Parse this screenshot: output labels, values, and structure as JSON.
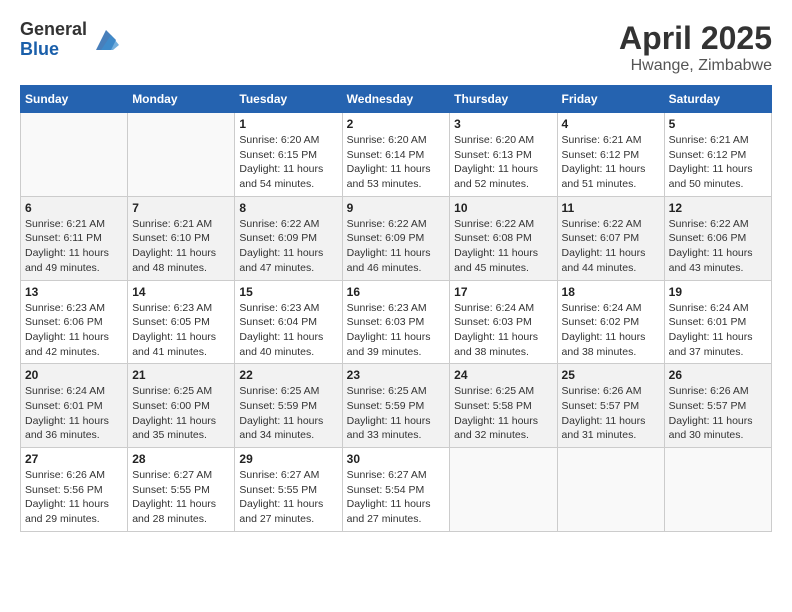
{
  "header": {
    "logo_general": "General",
    "logo_blue": "Blue",
    "title": "April 2025",
    "location": "Hwange, Zimbabwe"
  },
  "calendar": {
    "days_of_week": [
      "Sunday",
      "Monday",
      "Tuesday",
      "Wednesday",
      "Thursday",
      "Friday",
      "Saturday"
    ],
    "weeks": [
      [
        {
          "day": "",
          "info": ""
        },
        {
          "day": "",
          "info": ""
        },
        {
          "day": "1",
          "info": "Sunrise: 6:20 AM\nSunset: 6:15 PM\nDaylight: 11 hours\nand 54 minutes."
        },
        {
          "day": "2",
          "info": "Sunrise: 6:20 AM\nSunset: 6:14 PM\nDaylight: 11 hours\nand 53 minutes."
        },
        {
          "day": "3",
          "info": "Sunrise: 6:20 AM\nSunset: 6:13 PM\nDaylight: 11 hours\nand 52 minutes."
        },
        {
          "day": "4",
          "info": "Sunrise: 6:21 AM\nSunset: 6:12 PM\nDaylight: 11 hours\nand 51 minutes."
        },
        {
          "day": "5",
          "info": "Sunrise: 6:21 AM\nSunset: 6:12 PM\nDaylight: 11 hours\nand 50 minutes."
        }
      ],
      [
        {
          "day": "6",
          "info": "Sunrise: 6:21 AM\nSunset: 6:11 PM\nDaylight: 11 hours\nand 49 minutes."
        },
        {
          "day": "7",
          "info": "Sunrise: 6:21 AM\nSunset: 6:10 PM\nDaylight: 11 hours\nand 48 minutes."
        },
        {
          "day": "8",
          "info": "Sunrise: 6:22 AM\nSunset: 6:09 PM\nDaylight: 11 hours\nand 47 minutes."
        },
        {
          "day": "9",
          "info": "Sunrise: 6:22 AM\nSunset: 6:09 PM\nDaylight: 11 hours\nand 46 minutes."
        },
        {
          "day": "10",
          "info": "Sunrise: 6:22 AM\nSunset: 6:08 PM\nDaylight: 11 hours\nand 45 minutes."
        },
        {
          "day": "11",
          "info": "Sunrise: 6:22 AM\nSunset: 6:07 PM\nDaylight: 11 hours\nand 44 minutes."
        },
        {
          "day": "12",
          "info": "Sunrise: 6:22 AM\nSunset: 6:06 PM\nDaylight: 11 hours\nand 43 minutes."
        }
      ],
      [
        {
          "day": "13",
          "info": "Sunrise: 6:23 AM\nSunset: 6:06 PM\nDaylight: 11 hours\nand 42 minutes."
        },
        {
          "day": "14",
          "info": "Sunrise: 6:23 AM\nSunset: 6:05 PM\nDaylight: 11 hours\nand 41 minutes."
        },
        {
          "day": "15",
          "info": "Sunrise: 6:23 AM\nSunset: 6:04 PM\nDaylight: 11 hours\nand 40 minutes."
        },
        {
          "day": "16",
          "info": "Sunrise: 6:23 AM\nSunset: 6:03 PM\nDaylight: 11 hours\nand 39 minutes."
        },
        {
          "day": "17",
          "info": "Sunrise: 6:24 AM\nSunset: 6:03 PM\nDaylight: 11 hours\nand 38 minutes."
        },
        {
          "day": "18",
          "info": "Sunrise: 6:24 AM\nSunset: 6:02 PM\nDaylight: 11 hours\nand 38 minutes."
        },
        {
          "day": "19",
          "info": "Sunrise: 6:24 AM\nSunset: 6:01 PM\nDaylight: 11 hours\nand 37 minutes."
        }
      ],
      [
        {
          "day": "20",
          "info": "Sunrise: 6:24 AM\nSunset: 6:01 PM\nDaylight: 11 hours\nand 36 minutes."
        },
        {
          "day": "21",
          "info": "Sunrise: 6:25 AM\nSunset: 6:00 PM\nDaylight: 11 hours\nand 35 minutes."
        },
        {
          "day": "22",
          "info": "Sunrise: 6:25 AM\nSunset: 5:59 PM\nDaylight: 11 hours\nand 34 minutes."
        },
        {
          "day": "23",
          "info": "Sunrise: 6:25 AM\nSunset: 5:59 PM\nDaylight: 11 hours\nand 33 minutes."
        },
        {
          "day": "24",
          "info": "Sunrise: 6:25 AM\nSunset: 5:58 PM\nDaylight: 11 hours\nand 32 minutes."
        },
        {
          "day": "25",
          "info": "Sunrise: 6:26 AM\nSunset: 5:57 PM\nDaylight: 11 hours\nand 31 minutes."
        },
        {
          "day": "26",
          "info": "Sunrise: 6:26 AM\nSunset: 5:57 PM\nDaylight: 11 hours\nand 30 minutes."
        }
      ],
      [
        {
          "day": "27",
          "info": "Sunrise: 6:26 AM\nSunset: 5:56 PM\nDaylight: 11 hours\nand 29 minutes."
        },
        {
          "day": "28",
          "info": "Sunrise: 6:27 AM\nSunset: 5:55 PM\nDaylight: 11 hours\nand 28 minutes."
        },
        {
          "day": "29",
          "info": "Sunrise: 6:27 AM\nSunset: 5:55 PM\nDaylight: 11 hours\nand 27 minutes."
        },
        {
          "day": "30",
          "info": "Sunrise: 6:27 AM\nSunset: 5:54 PM\nDaylight: 11 hours\nand 27 minutes."
        },
        {
          "day": "",
          "info": ""
        },
        {
          "day": "",
          "info": ""
        },
        {
          "day": "",
          "info": ""
        }
      ]
    ]
  }
}
